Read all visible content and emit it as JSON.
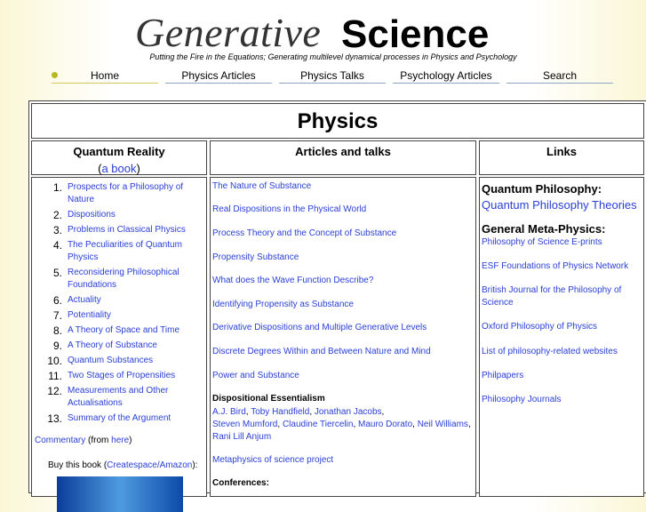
{
  "header": {
    "logo_generative": "Generative",
    "logo_science": "Science",
    "tagline": "Putting the Fire in the Equations;     Generating multilevel dynamical processes in Physics and Psychology"
  },
  "nav": [
    "Home",
    "Physics Articles",
    "Physics Talks",
    "Psychology Articles",
    "Search"
  ],
  "page_title": "Physics",
  "columns": {
    "quantum": {
      "title": "Quantum Reality",
      "paren_open": "(",
      "book_link": "a book",
      "paren_close": ")"
    },
    "articles": {
      "title": "Articles and talks"
    },
    "links": {
      "title": "Links"
    }
  },
  "toc": [
    {
      "n": "1.",
      "t": "Prospects for a Philosophy of Nature"
    },
    {
      "n": "2.",
      "t": "Dispositions"
    },
    {
      "n": "3.",
      "t": "Problems in Classical Physics"
    },
    {
      "n": "4.",
      "t": "The Peculiarities of Quantum Physics"
    },
    {
      "n": "5.",
      "t": "Reconsidering Philosophical Foundations"
    },
    {
      "n": "6.",
      "t": "Actuality"
    },
    {
      "n": "7.",
      "t": "Potentiality"
    },
    {
      "n": "8.",
      "t": "A Theory of Space and Time"
    },
    {
      "n": "9.",
      "t": "A Theory of Substance"
    },
    {
      "n": "10.",
      "t": "Quantum Substances"
    },
    {
      "n": "11.",
      "t": "Two Stages of Propensities"
    },
    {
      "n": "12.",
      "t": "Measurements and Other Actualisations"
    },
    {
      "n": "13.",
      "t": "Summary of the Argument"
    }
  ],
  "commentary": {
    "link": "Commentary",
    "mid": " (from ",
    "here": "here",
    "end": ")"
  },
  "buy": {
    "pre": "Buy this book (",
    "link": "Createspace/Amazon",
    "post": "):"
  },
  "articles": [
    "The Nature of Substance",
    "Real Dispositions in the Physical World",
    "Process Theory and the Concept of Substance",
    "Propensity Substance",
    "What does the Wave Function Describe?",
    "Identifying Propensity as Substance",
    "Derivative Dispositions and Multiple Generative Levels",
    "Discrete Degrees Within and Between Nature and Mind",
    "Power and Substance"
  ],
  "dispositional": {
    "heading": "Dispositional Essentialism",
    "people": [
      "A.J. Bird",
      "Toby Handfield",
      "Jonathan Jacobs",
      "Steven Mumford",
      "Claudine Tiercelin",
      "Mauro Dorato",
      "Neil Williams",
      "Rani Lill Anjum"
    ]
  },
  "metaphysics_project": "Metaphysics of science project",
  "conferences": "Conferences:",
  "links": {
    "quantum_heading": "Quantum Philosophy:",
    "quantum_link": "Quantum Philosophy Theories",
    "general_heading": "General Meta-Physics:",
    "items": [
      "Philosophy of Science E-prints",
      "ESF Foundations of Physics Network",
      "British Journal for the Philosophy of Science",
      "Oxford Philosophy of Physics",
      "List of philosophy-related websites",
      "Philpapers",
      "Philosophy Journals"
    ]
  }
}
